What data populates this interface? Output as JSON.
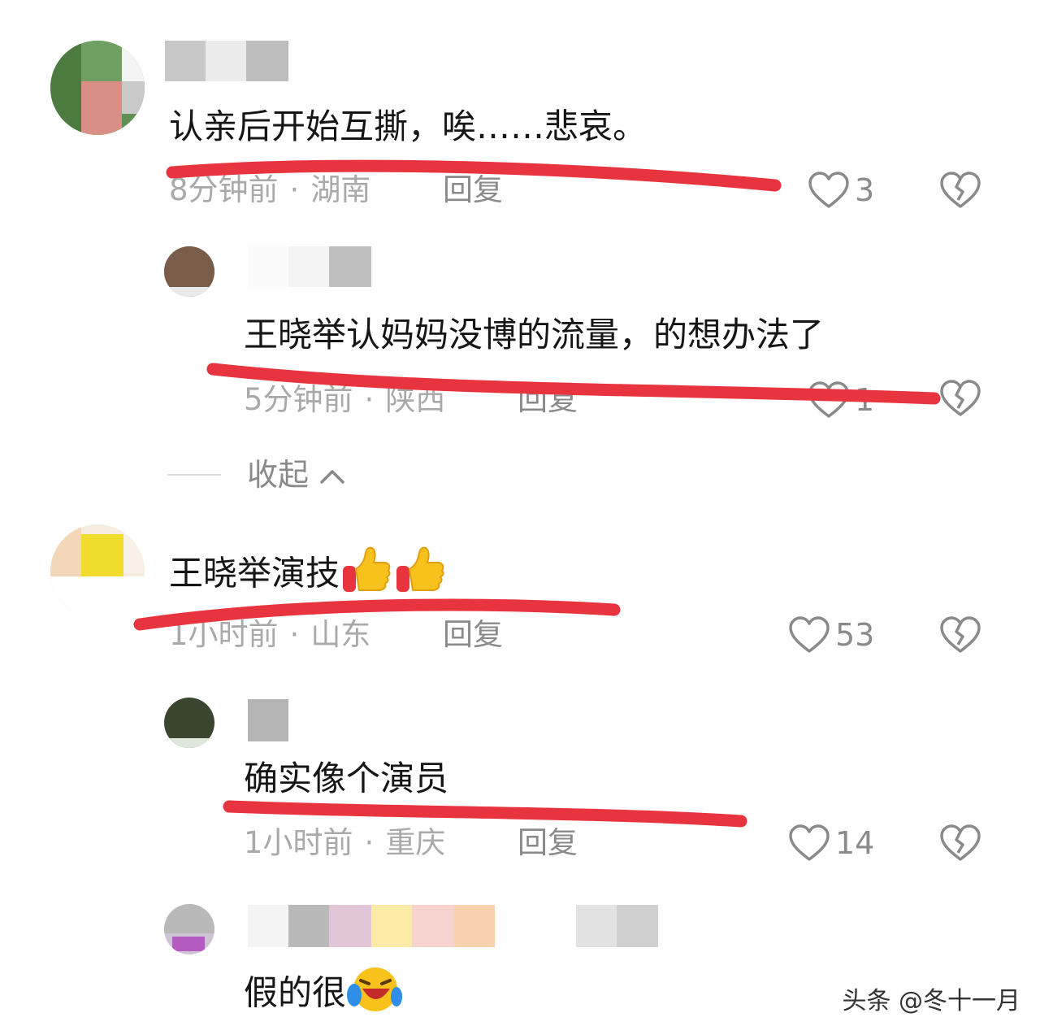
{
  "comments": [
    {
      "text": "认亲后开始互撕，唉……悲哀。",
      "time": "8分钟前",
      "location": "湖南",
      "reply_label": "回复",
      "likes": "3"
    },
    {
      "text": "王晓举认妈妈没博的流量，的想办法了",
      "time": "5分钟前",
      "location": "陕西",
      "reply_label": "回复",
      "likes": "1"
    },
    {
      "text": "王晓举演技",
      "time": "1小时前",
      "location": "山东",
      "reply_label": "回复",
      "likes": "53"
    },
    {
      "text": "确实像个演员",
      "time": "1小时前",
      "location": "重庆",
      "reply_label": "回复",
      "likes": "14"
    },
    {
      "text": "假的很"
    }
  ],
  "collapse_label": "收起",
  "watermark": "头条 @冬十一月",
  "icons": {
    "like": "heart-icon",
    "dislike": "broken-heart-icon",
    "collapse": "chevron-up-icon",
    "thumbs_up": "thumbs-up-emoji",
    "laughing": "laughing-crying-emoji"
  },
  "colors": {
    "underline": "#e8343f",
    "meta": "#a9a9a9"
  }
}
